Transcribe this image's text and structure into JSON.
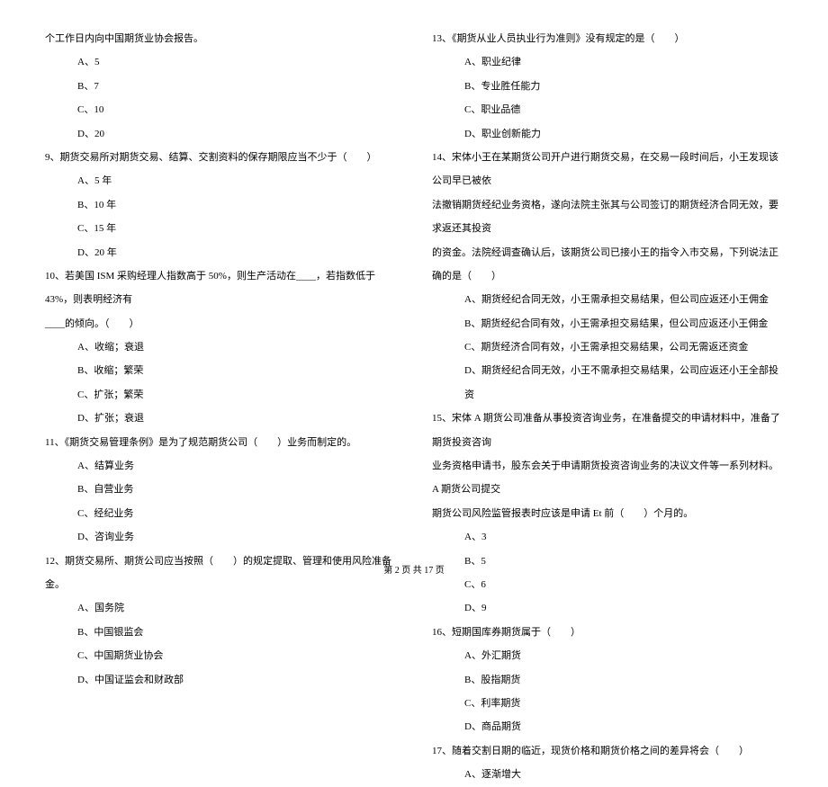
{
  "left_column": {
    "q8_trailing": "个工作日内向中国期货业协会报告。",
    "q8_options": [
      "A、5",
      "B、7",
      "C、10",
      "D、20"
    ],
    "q9": "9、期货交易所对期货交易、结算、交割资料的保存期限应当不少于（　　）",
    "q9_options": [
      "A、5 年",
      "B、10 年",
      "C、15 年",
      "D、20 年"
    ],
    "q10": "10、若美国 ISM 采购经理人指数高于 50%，则生产活动在____，若指数低于 43%，则表明经济有",
    "q10_trailing": "____的倾向。（　　）",
    "q10_options": [
      "A、收缩；衰退",
      "B、收缩；繁荣",
      "C、扩张；繁荣",
      "D、扩张；衰退"
    ],
    "q11": "11、《期货交易管理条例》是为了规范期货公司（　　）业务而制定的。",
    "q11_options": [
      "A、结算业务",
      "B、自营业务",
      "C、经纪业务",
      "D、咨询业务"
    ],
    "q12": "12、期货交易所、期货公司应当按照（　　）的规定提取、管理和使用风险准备金。",
    "q12_options": [
      "A、国务院",
      "B、中国银监会",
      "C、中国期货业协会",
      "D、中国证监会和财政部"
    ]
  },
  "right_column": {
    "q13": "13、《期货从业人员执业行为准则》没有规定的是（　　）",
    "q13_options": [
      "A、职业纪律",
      "B、专业胜任能力",
      "C、职业品德",
      "D、职业创新能力"
    ],
    "q14": "14、宋体小王在某期货公司开户进行期货交易，在交易一段时间后，小王发现该公司早已被依",
    "q14_line2": "法撤销期货经纪业务资格，遂向法院主张其与公司签订的期货经济合同无效，要求返还其投资",
    "q14_line3": "的资金。法院经调查确认后，该期货公司已接小王的指令入市交易，下列说法正确的是（　　）",
    "q14_options": [
      "A、期货经纪合同无效，小王需承担交易结果，但公司应返还小王佣金",
      "B、期货经纪合同有效，小王需承担交易结果，但公司应返还小王佣金",
      "C、期货经济合同有效，小王需承担交易结果，公司无需返还资金",
      "D、期货经纪合同无效，小王不需承担交易结果，公司应返还小王全部投资"
    ],
    "q15": "15、宋体 A 期货公司准备从事投资咨询业务，在准备提交的申请材料中，准备了期货投资咨询",
    "q15_line2": "业务资格申请书，股东会关于申请期货投资咨询业务的决议文件等一系列材料。A 期货公司提交",
    "q15_line3": "期货公司风险监管报表时应该是申请 Et 前（　　）个月的。",
    "q15_options": [
      "A、3",
      "B、5",
      "C、6",
      "D、9"
    ],
    "q16": "16、短期国库券期货属于（　　）",
    "q16_options": [
      "A、外汇期货",
      "B、股指期货",
      "C、利率期货",
      "D、商品期货"
    ],
    "q17": "17、随着交割日期的临近，现货价格和期货价格之间的差异将会（　　）",
    "q17_options": [
      "A、逐渐增大"
    ]
  },
  "footer": "第 2 页 共 17 页"
}
